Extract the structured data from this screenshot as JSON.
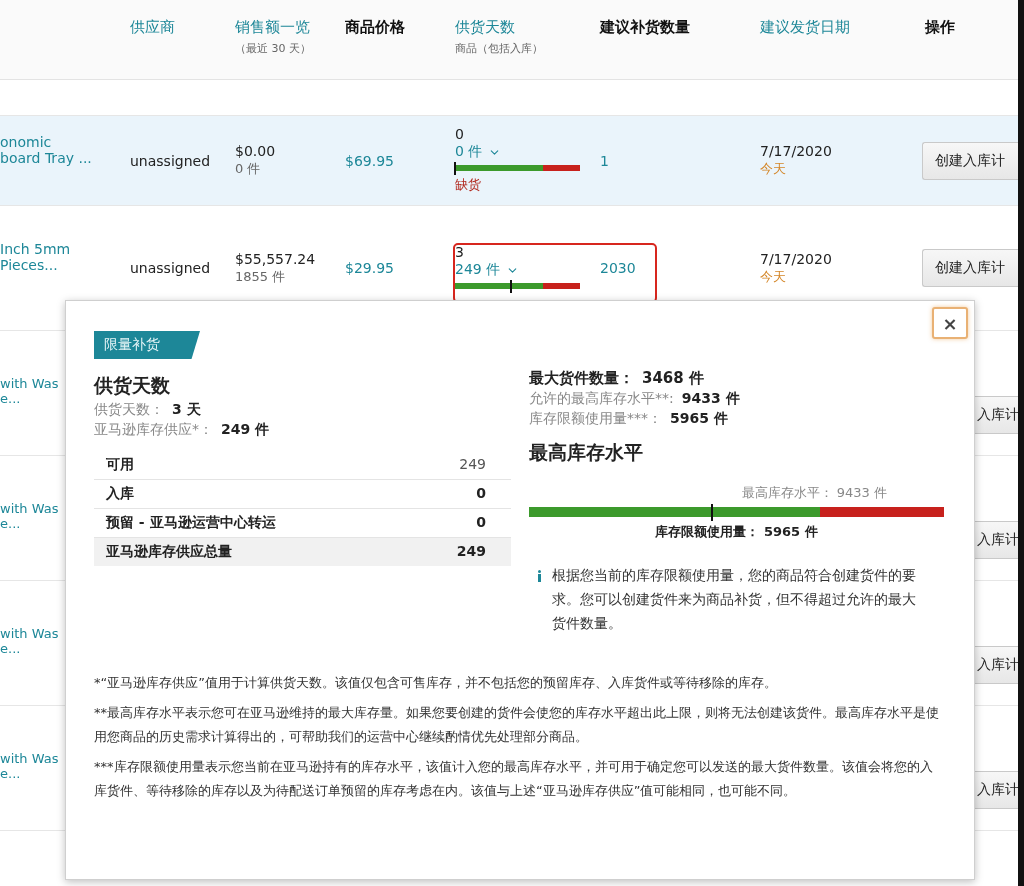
{
  "table": {
    "columns": [
      {
        "label": "供应商",
        "sortable": true
      },
      {
        "label": "销售额一览",
        "note": "（最近 30 天）",
        "sortable": true
      },
      {
        "label": "商品价格",
        "sortable": false
      },
      {
        "label": "供货天数",
        "note": "商品（包括入库）",
        "sortable": true
      },
      {
        "label": "建议补货数量",
        "sortable": false
      },
      {
        "label": "建议发货日期",
        "sortable": true
      },
      {
        "label": "操作",
        "sortable": false
      }
    ],
    "rows": [
      {
        "name_lines": [
          "onomic",
          "board Tray ..."
        ],
        "supplier": "unassigned",
        "sales": "$0.00",
        "units": "0 件",
        "price": "$69.95",
        "days": "0",
        "stock": "0 件",
        "level": 0,
        "status": "缺货",
        "quantity": "1",
        "date": "7/17/2020",
        "date_note": "今天",
        "action": "创建入库计",
        "highlighted": true,
        "outlined": false
      },
      {
        "name_lines": [
          "Inch 5mm",
          "Pieces..."
        ],
        "supplier": "unassigned",
        "sales": "$55,557.24",
        "units": "1855 件",
        "price": "$29.95",
        "days": "3",
        "stock": "249 件",
        "level": 0.45,
        "quantity": "2030",
        "date": "7/17/2020",
        "date_note": "今天",
        "action": "创建入库计",
        "highlighted": false,
        "outlined": true
      }
    ],
    "rows_behind_popup": [
      {
        "name_lines": [
          "with Was",
          "e..."
        ],
        "action": "入库计"
      },
      {
        "name_lines": [
          "with Was",
          "e..."
        ],
        "action": "入库计"
      },
      {
        "name_lines": [
          "with Was",
          "e..."
        ],
        "action": "入库计"
      },
      {
        "name_lines": [
          "with Was",
          "e..."
        ],
        "action": "入库计"
      }
    ]
  },
  "popup": {
    "tag": "限量补货",
    "close": "×",
    "left": {
      "title": "供货天数",
      "summary": [
        {
          "label": "供货天数：",
          "value": "3 天"
        },
        {
          "label": "亚马逊库存供应*：",
          "value": "249 件"
        }
      ],
      "rows": [
        {
          "label": "可用",
          "value": "249",
          "kind": "plain"
        },
        {
          "label": "入库",
          "value": "0",
          "kind": "bold"
        },
        {
          "label": "预留 - 亚马逊运营中心转运",
          "value": "0",
          "kind": "bold"
        },
        {
          "label": "亚马逊库存供应总量",
          "value": "249",
          "kind": "total"
        }
      ]
    },
    "right": {
      "facts": [
        {
          "label": "最大货件数量：",
          "value": "3468 件",
          "kind": "headline"
        },
        {
          "label": "允许的最高库存水平**:",
          "value": "9433 件",
          "kind": "note"
        },
        {
          "label": "库存限额使用量***：",
          "value": "5965 件",
          "kind": "note"
        }
      ],
      "title": "最高库存水平",
      "gauge": {
        "top_label": "最高库存水平： 9433 件",
        "bottom_label": "库存限额使用量： 5965 件",
        "level": 0.44
      },
      "info": "根据您当前的库存限额使用量，您的商品符合创建货件的要求。您可以创建货件来为商品补货，但不得超过允许的最大货件数量。"
    },
    "footnotes": [
      "*“亚马逊库存供应”值用于计算供货天数。该值仅包含可售库存，并不包括您的预留库存、入库货件或等待移除的库存。",
      "**最高库存水平表示您可在亚马逊维持的最大库存量。如果您要创建的货件会使您的库存水平超出此上限，则将无法创建该货件。最高库存水平是使用您商品的历史需求计算得出的，可帮助我们的运营中心继续酌情优先处理部分商品。",
      "***库存限额使用量表示您当前在亚马逊持有的库存水平，该值计入您的最高库存水平，并可用于确定您可以发送的最大货件数量。该值会将您的入库货件、等待移除的库存以及为待配送订单预留的库存考虑在内。该值与上述“亚马逊库存供应”值可能相同，也可能不同。"
    ]
  }
}
